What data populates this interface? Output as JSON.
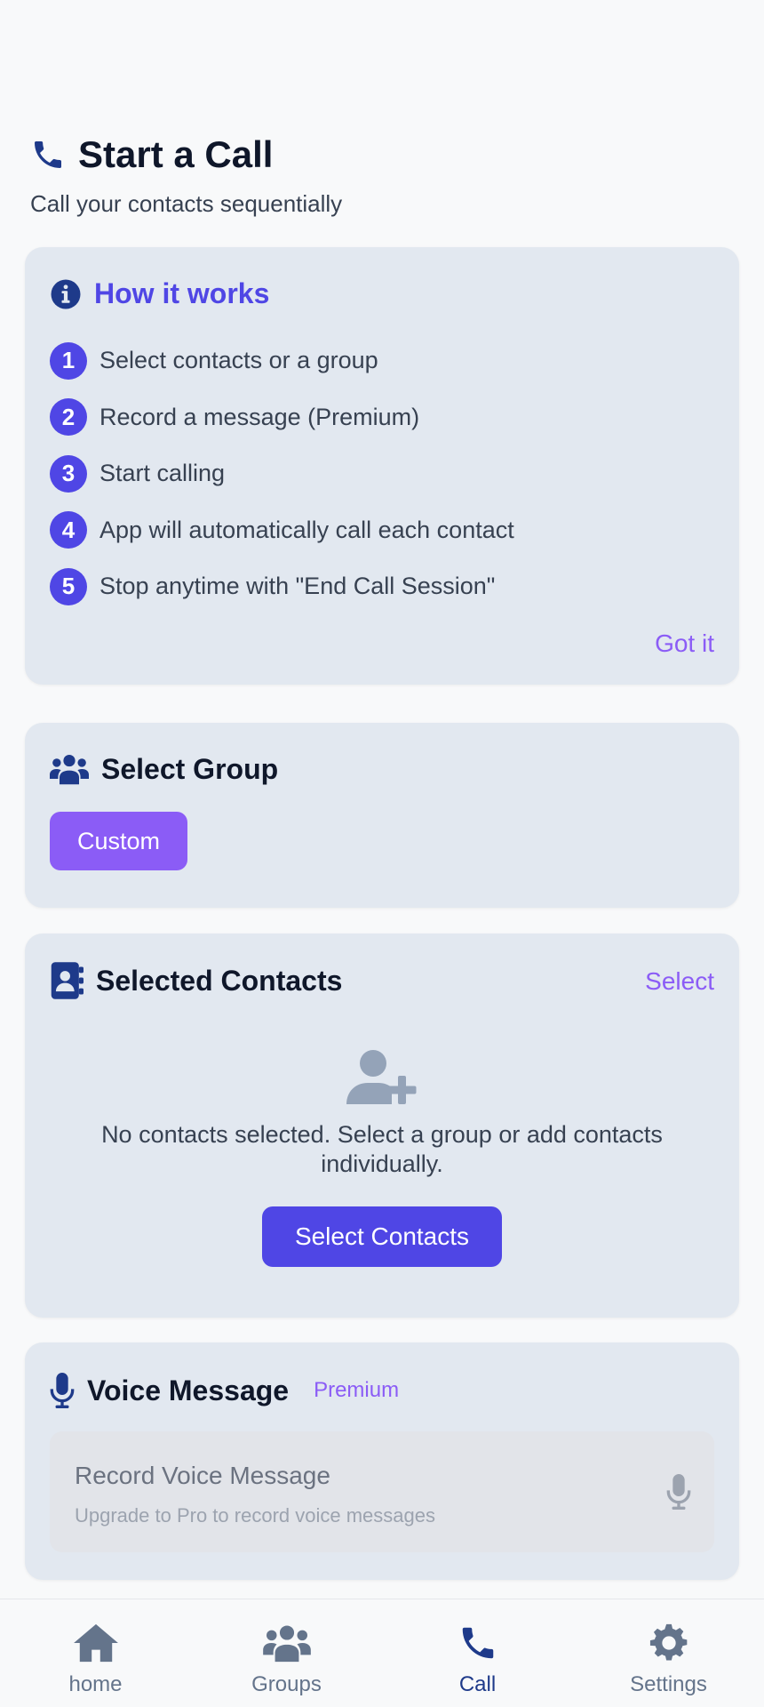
{
  "header": {
    "title": "Start a Call",
    "subtitle": "Call your contacts sequentially",
    "icon": "phone-icon"
  },
  "how_it_works": {
    "title": "How it works",
    "icon": "info-icon",
    "steps": [
      {
        "num": "1",
        "text": "Select contacts or a group"
      },
      {
        "num": "2",
        "text": "Record a message (Premium)"
      },
      {
        "num": "3",
        "text": "Start calling"
      },
      {
        "num": "4",
        "text": "App will automatically call each contact"
      },
      {
        "num": "5",
        "text": "Stop anytime with \"End Call Session\""
      }
    ],
    "dismiss_label": "Got it"
  },
  "select_group": {
    "title": "Select Group",
    "icon": "users-icon",
    "options": [
      "Custom"
    ]
  },
  "selected_contacts": {
    "title": "Selected Contacts",
    "icon": "address-book-icon",
    "select_label": "Select",
    "empty_icon": "user-plus-icon",
    "empty_text": "No contacts selected. Select a group or add contacts individually.",
    "button_label": "Select Contacts"
  },
  "voice_message": {
    "title": "Voice Message",
    "icon": "microphone-icon",
    "badge": "Premium",
    "record_title": "Record Voice Message",
    "record_subtitle": "Upgrade to Pro to record voice messages"
  },
  "bottom_nav": {
    "items": [
      {
        "label": "home",
        "icon": "home-icon"
      },
      {
        "label": "Groups",
        "icon": "users-icon"
      },
      {
        "label": "Call",
        "icon": "phone-icon",
        "active": true
      },
      {
        "label": "Settings",
        "icon": "gear-icon"
      }
    ]
  },
  "colors": {
    "accent": "#4f46e5",
    "accent_light": "#8b5cf6",
    "card_bg": "#e2e8f0",
    "nav_active": "#1e3a8a",
    "nav_inactive": "#64748b"
  }
}
